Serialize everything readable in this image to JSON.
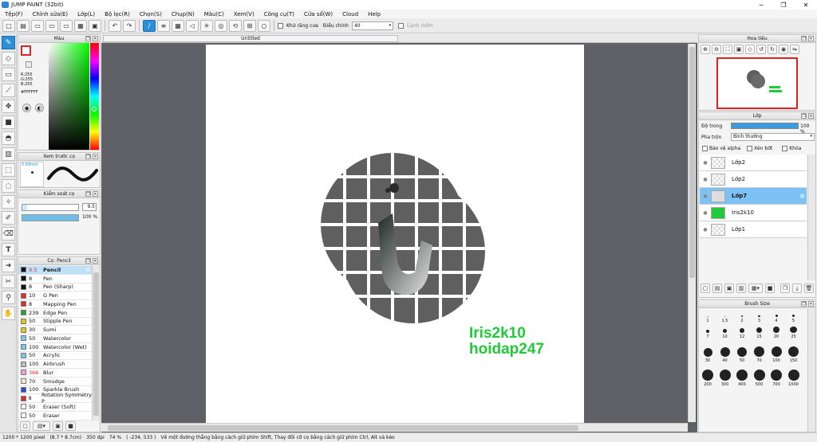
{
  "window": {
    "title": "JUMP PAINT (32bit)",
    "min": "─",
    "max": "❐",
    "close": "✕"
  },
  "menu": [
    "Tệp(F)",
    "Chỉnh sửa(E)",
    "Lớp(L)",
    "Bộ lọc(R)",
    "Chọn(S)",
    "Chụp(N)",
    "Màu(C)",
    "Xem(V)",
    "Công cụ(T)",
    "Cửa sổ(W)",
    "Cloud",
    "Help"
  ],
  "toolbar": {
    "antialias_label": "Khử răng cưa",
    "correction_label": "Điều chỉnh",
    "correction_value": "40",
    "edge_label": "Cạnh mềm"
  },
  "doc": {
    "tab": "Untitled",
    "watermark1": "Iris2k10",
    "watermark2": "hoidap247"
  },
  "color_panel": {
    "title": "Màu",
    "r": "R:255",
    "g": "G:255",
    "b": "B:255",
    "hex": "#FFFFFF"
  },
  "brush_preview": {
    "title": "Xem trước cọ",
    "size": "0.69mm"
  },
  "brush_control": {
    "title": "Kiểm soát cọ",
    "size": "9.5",
    "opacity": "100 %"
  },
  "brush_list": {
    "title": "Cọ: Pencil",
    "items": [
      {
        "size": "9.5",
        "name": "Pencil",
        "color": "#111111"
      },
      {
        "size": "8",
        "name": "Pen",
        "color": "#111111"
      },
      {
        "size": "8",
        "name": "Pen (Sharp)",
        "color": "#111111"
      },
      {
        "size": "10",
        "name": "G Pen",
        "color": "#d9302b"
      },
      {
        "size": "8",
        "name": "Mapping Pen",
        "color": "#d9302b"
      },
      {
        "size": "239",
        "name": "Edge Pen",
        "color": "#2aa32a"
      },
      {
        "size": "50",
        "name": "Stipple Pen",
        "color": "#e0c81a"
      },
      {
        "size": "30",
        "name": "Sumi",
        "color": "#e0c81a"
      },
      {
        "size": "50",
        "name": "Watercolor",
        "color": "#7cc8ea"
      },
      {
        "size": "100",
        "name": "Watercolor (Wet)",
        "color": "#7cc8ea"
      },
      {
        "size": "50",
        "name": "Acrylic",
        "color": "#7cc8ea"
      },
      {
        "size": "100",
        "name": "Airbrush",
        "color": "#bbbbbb"
      },
      {
        "size": "366",
        "name": "Blur",
        "color": "#f0a0d8"
      },
      {
        "size": "70",
        "name": "Smudge",
        "color": "#f2e7c7"
      },
      {
        "size": "100",
        "name": "Sparkle Brush",
        "color": "#2a4bd8"
      },
      {
        "size": "8",
        "name": "Rotation Symmetry P",
        "color": "#d9302b"
      },
      {
        "size": "50",
        "name": "Eraser (Soft)",
        "color": "#ffffff"
      },
      {
        "size": "50",
        "name": "Eraser",
        "color": "#ffffff"
      }
    ]
  },
  "navigator": {
    "title": "Hoa tiêu"
  },
  "layers": {
    "title": "Lớp",
    "opacity_label": "Độ trong",
    "opacity_value": "100 %",
    "blend_label": "Pha trộn",
    "blend_value": "Bình thường",
    "protect_alpha": "Bảo vệ alpha",
    "clipping": "Xén bớt",
    "lock": "Khóa",
    "items": [
      "Lớp2",
      "Lớp2",
      "Lớp7",
      "Iris2k10",
      "Lớp1"
    ]
  },
  "brush_size": {
    "title": "Brush Size",
    "sizes": [
      "1",
      "1.5",
      "2",
      "3",
      "4",
      "5",
      "7",
      "10",
      "12",
      "15",
      "20",
      "25",
      "30",
      "40",
      "50",
      "70",
      "100",
      "150",
      "200",
      "300",
      "400",
      "500",
      "700",
      "1000"
    ]
  },
  "status": {
    "dims": "1200 * 1200 pixel",
    "cm": "(8.7 * 8.7cm)",
    "dpi": "350 dpi",
    "zoom": "74 %",
    "coords": "( -234, 533 )",
    "hint": "Vẽ một đường thẳng bằng cách giữ phím Shift, Thay đổi cỡ cọ bằng cách giữ phím Ctrl, Alt và kéo"
  },
  "colors": {
    "accent": "#2b8fd9",
    "canvas_bg": "#5f6166",
    "shape": "#5a5a5a",
    "watermark": "#22c93a"
  }
}
